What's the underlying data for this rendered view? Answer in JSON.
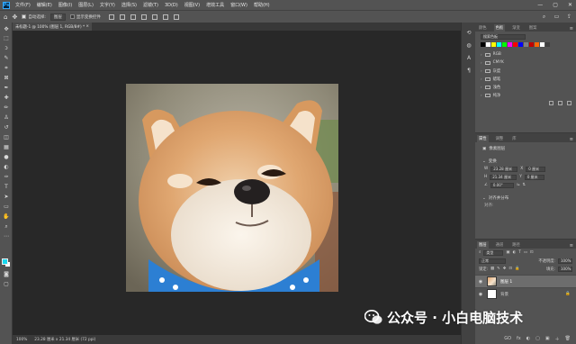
{
  "app": {
    "logo": "Ps"
  },
  "menubar": {
    "items": [
      "文件(F)",
      "编辑(E)",
      "图像(I)",
      "图层(L)",
      "文字(Y)",
      "选择(S)",
      "滤镜(T)",
      "3D(D)",
      "视图(V)",
      "增效工具",
      "窗口(W)",
      "帮助(H)"
    ],
    "controls": {
      "minimize": "—",
      "maximize": "▢",
      "close": "✕"
    }
  },
  "options": {
    "auto_select_label": "自动选择:",
    "auto_select_value": "图层",
    "transform_controls_label": "显示变换控件"
  },
  "document": {
    "tab_title": "未标题-1 @ 100% (图层 1, RGB/8#) *",
    "tab_close": "×"
  },
  "statusbar": {
    "zoom": "100%",
    "info": "23.28 厘米 x 21.34 厘米 (72 ppi)"
  },
  "panels": {
    "swatches_tabs": [
      "颜色",
      "色板",
      "渐变",
      "图案"
    ],
    "swatches_active": 1,
    "swatch_search_placeholder": "搜索色板",
    "swatch_colors": [
      "#000000",
      "#ffffff",
      "#ffff00",
      "#00ffff",
      "#00ff00",
      "#ff00ff",
      "#ff0000",
      "#0000ff",
      "#7f7f7f",
      "#c00000",
      "#ff6600",
      "#ffffff",
      "#3f3f3f"
    ],
    "swatch_groups": [
      "RGB",
      "CMYK",
      "灰度",
      "蜡笔",
      "浅色",
      "纯净"
    ],
    "properties_tabs": [
      "属性",
      "调整",
      "库"
    ],
    "properties_active": 0,
    "pixel_layer_label": "像素图层",
    "transform_label": "变换",
    "w_label": "W",
    "w_value": "23.28 厘米",
    "h_label": "H",
    "h_value": "21.34 厘米",
    "x_label": "X",
    "x_value": "0 厘米",
    "y_label": "Y",
    "y_value": "0 厘米",
    "angle_value": "0.00°",
    "align_label": "对齐并分布",
    "align_sub": "对齐:",
    "layers_tabs": [
      "图层",
      "通道",
      "路径"
    ],
    "layers_active": 0,
    "filter_kind": "类型",
    "blend_mode": "正常",
    "opacity_label": "不透明度:",
    "opacity_value": "100%",
    "lock_label": "锁定:",
    "fill_label": "填充:",
    "fill_value": "100%",
    "layers": [
      {
        "name": "图层 1",
        "visible": "◉",
        "selected": true,
        "thumb": "dog"
      },
      {
        "name": "背景",
        "visible": "◉",
        "selected": false,
        "thumb": "white"
      }
    ],
    "layer_footer": [
      "GO",
      "fx",
      "◐",
      "▢",
      "▣",
      "＋",
      "🗑"
    ]
  },
  "watermark": {
    "text": "公众号 · 小白电脑技术"
  },
  "colors": {
    "foreground": "#18d8f0",
    "background": "#ffffff",
    "workspace": "#282828",
    "panel": "#535353"
  }
}
